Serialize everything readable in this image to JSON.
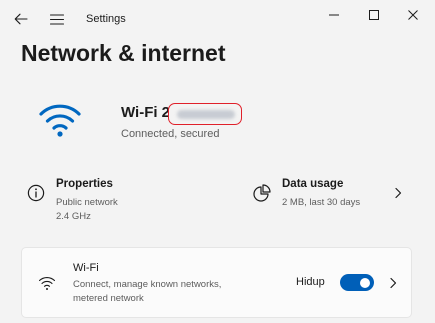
{
  "window": {
    "title": "Settings"
  },
  "page": {
    "title": "Network & internet"
  },
  "connection": {
    "name": "Wi-Fi 2",
    "status": "Connected, secured",
    "icon": "wifi-icon",
    "redacted_name": true
  },
  "properties": {
    "title": "Properties",
    "network_type": "Public network",
    "band": "2.4 GHz",
    "icon": "info-icon"
  },
  "data_usage": {
    "title": "Data usage",
    "summary": "2 MB, last 30 days",
    "icon": "pie-chart-icon"
  },
  "wifi_card": {
    "title": "Wi-Fi",
    "description": "Connect, manage known networks, metered network",
    "toggle_label": "Hidup",
    "toggle_on": true,
    "icon": "wifi-icon"
  },
  "colors": {
    "accent": "#005fb8",
    "wifi_icon": "#0067c0",
    "highlight_outline": "#e0202a",
    "background": "#f3f3f3"
  }
}
